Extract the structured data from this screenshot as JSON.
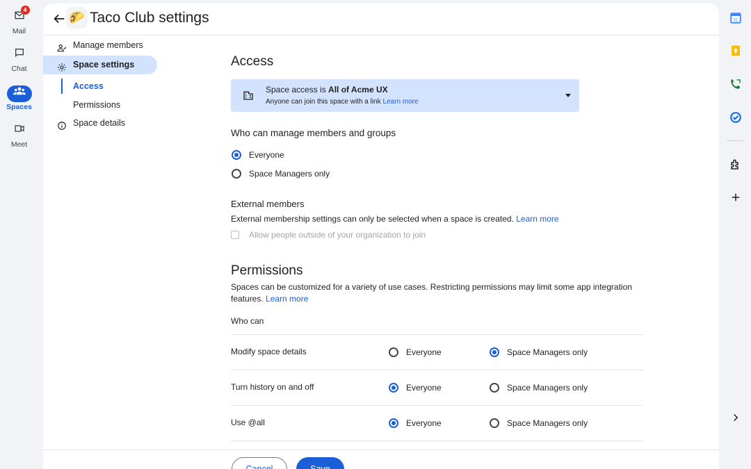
{
  "left_rail": {
    "items": [
      {
        "label": "Mail",
        "badge": "4",
        "icon": "mail-icon"
      },
      {
        "label": "Chat",
        "icon": "chat-icon"
      },
      {
        "label": "Spaces",
        "icon": "spaces-icon",
        "active": true
      },
      {
        "label": "Meet",
        "icon": "meet-icon"
      }
    ]
  },
  "header": {
    "title": "Taco Club settings",
    "space_emoji": "🌮"
  },
  "settings_nav": {
    "items": [
      {
        "label": "Manage members",
        "icon": "manage-members-icon"
      },
      {
        "label": "Space settings",
        "icon": "gear-icon",
        "selected": true
      },
      {
        "label": "Space details",
        "icon": "info-icon"
      }
    ],
    "sub_items": [
      {
        "label": "Access",
        "current": true
      },
      {
        "label": "Permissions"
      }
    ]
  },
  "access": {
    "heading": "Access",
    "dropdown": {
      "prefix": "Space access is ",
      "value": "All of Acme UX",
      "description": "Anyone can join this space with a link ",
      "learn_more": "Learn more"
    },
    "manage_heading": "Who can manage members and groups",
    "manage_options": [
      {
        "label": "Everyone",
        "checked": true
      },
      {
        "label": "Space Managers only",
        "checked": false
      }
    ],
    "external": {
      "heading": "External members",
      "description": "External membership settings can only be selected when a space is created. ",
      "learn_more": "Learn more",
      "checkbox_label": "Allow people outside of your organization to join"
    }
  },
  "permissions": {
    "heading": "Permissions",
    "description": "Spaces can be customized for a variety of use cases. Restricting permissions may limit some app integration features. ",
    "learn_more": "Learn more",
    "who_can": "Who can",
    "option_everyone": "Everyone",
    "option_managers": "Space Managers only",
    "rows": [
      {
        "name": "Modify space details",
        "selected": "managers"
      },
      {
        "name": "Turn history on and off",
        "selected": "everyone"
      },
      {
        "name": "Use @all",
        "selected": "everyone"
      }
    ]
  },
  "footer": {
    "cancel_label": "Cancel",
    "save_label": "Save"
  },
  "right_rail": {
    "icons": [
      "calendar-icon",
      "keep-icon",
      "voice-icon",
      "tasks-icon",
      "addons-icon",
      "add-icon",
      "chevron-right-icon"
    ]
  },
  "colors": {
    "accent": "#1a5fd8",
    "selected_bg": "#d3e3fd",
    "badge": "#d93025"
  }
}
